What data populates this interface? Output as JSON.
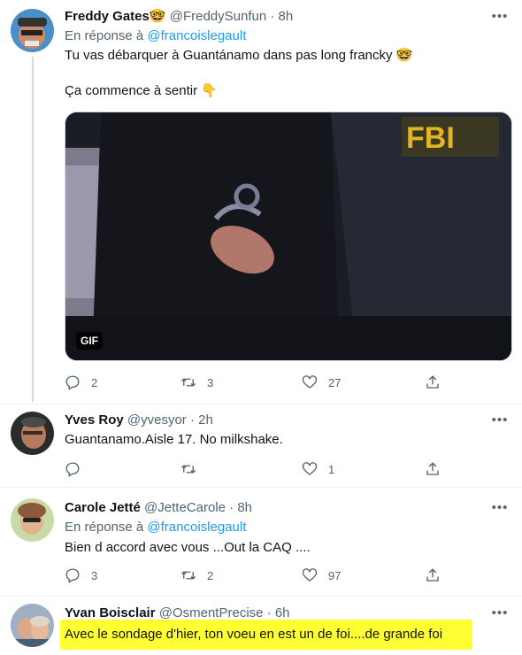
{
  "tweets": [
    {
      "name": "Freddy Gates",
      "name_emoji": "🤓",
      "handle": "@FreddySunfun",
      "dot": "·",
      "time": "8h",
      "reply_prefix": "En réponse à",
      "reply_mention": "@francoislegault",
      "text_line1": "Tu vas débarquer à Guantánamo dans pas long francky 🤓",
      "text_line2": "Ça commence à sentir 👇",
      "media_badge": "GIF",
      "replies": "2",
      "retweets": "3",
      "likes": "27"
    },
    {
      "name": "Yves Roy",
      "handle": "@yvesyor",
      "dot": "·",
      "time": "2h",
      "text_line1": "Guantanamo.Aisle 17. No milkshake.",
      "replies": "",
      "retweets": "",
      "likes": "1"
    },
    {
      "name": "Carole Jetté",
      "handle": "@JetteCarole",
      "dot": "·",
      "time": "8h",
      "reply_prefix": "En réponse à",
      "reply_mention": "@francoislegault",
      "text_line1": "Bien d accord avec vous ...Out la CAQ ....",
      "replies": "3",
      "retweets": "2",
      "likes": "97"
    },
    {
      "name": "Yvan Boisclair",
      "handle": "@OsmentPrecise",
      "dot": "·",
      "time": "6h",
      "text_line1": "Avec le sondage d'hier, ton voeu en est un de foi....de grande foi"
    }
  ],
  "colors": {
    "link": "#1d9bf0",
    "secondary_text": "#536471",
    "highlight": "#ffff33"
  },
  "icons": {
    "more": "more-icon",
    "reply": "reply-icon",
    "retweet": "retweet-icon",
    "like": "like-icon",
    "share": "share-icon"
  }
}
